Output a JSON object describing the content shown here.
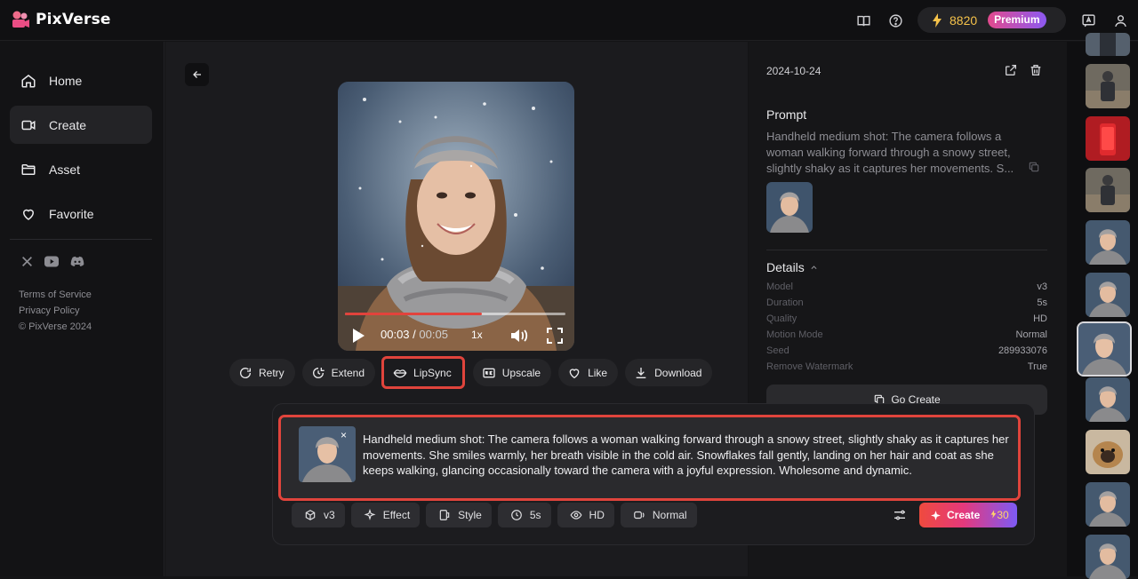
{
  "app": {
    "name": "PixVerse"
  },
  "header": {
    "credits": "8820",
    "badge": "Premium"
  },
  "sidebar": {
    "items": [
      {
        "label": "Home",
        "icon": "home-icon"
      },
      {
        "label": "Create",
        "icon": "video-icon",
        "active": true
      },
      {
        "label": "Asset",
        "icon": "folder-icon"
      },
      {
        "label": "Favorite",
        "icon": "heart-icon"
      }
    ],
    "social": [
      "x-icon",
      "youtube-icon",
      "discord-icon"
    ],
    "links": {
      "terms": "Terms of Service",
      "privacy": "Privacy Policy",
      "copyright": "© PixVerse 2024"
    }
  },
  "player": {
    "current": "00:03",
    "separator": "/",
    "duration": "00:05",
    "speed": "1x",
    "progress": 0.62
  },
  "actions": {
    "retry": "Retry",
    "extend": "Extend",
    "lipsync": "LipSync",
    "upscale": "Upscale",
    "like": "Like",
    "download": "Download"
  },
  "details_panel": {
    "date": "2024-10-24",
    "prompt_heading": "Prompt",
    "prompt_text": "Handheld medium shot: The camera follows a woman walking forward through a snowy street, slightly shaky as it captures her movements. S...",
    "details_heading": "Details",
    "details": [
      {
        "key": "Model",
        "value": "v3"
      },
      {
        "key": "Duration",
        "value": "5s"
      },
      {
        "key": "Quality",
        "value": "HD"
      },
      {
        "key": "Motion Mode",
        "value": "Normal"
      },
      {
        "key": "Seed",
        "value": "289933076"
      },
      {
        "key": "Remove Watermark",
        "value": "True"
      }
    ],
    "go_create": "Go Create"
  },
  "composer": {
    "prompt": "Handheld medium shot: The camera follows a woman walking forward through a snowy street, slightly shaky as it captures her movements. She smiles warmly, her breath visible in the cold air. Snowflakes fall gently, landing on her hair and coat as she keeps walking, glancing occasionally toward the camera with a joyful expression. Wholesome and dynamic.",
    "close": "×",
    "chips": {
      "model": "v3",
      "effect": "Effect",
      "style": "Style",
      "duration": "5s",
      "quality": "HD",
      "motion": "Normal"
    },
    "create": "Create",
    "cost": "30"
  },
  "colors": {
    "accent_red": "#e0443c",
    "credits_gold": "#f5c24a"
  }
}
